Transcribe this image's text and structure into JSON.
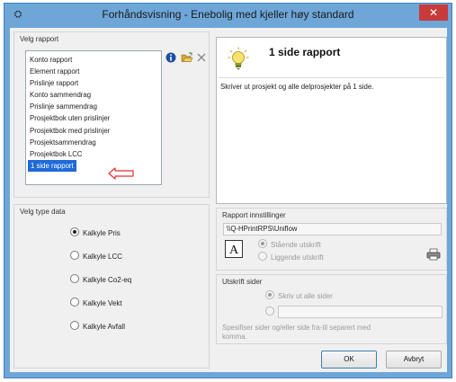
{
  "window": {
    "title": "Forhåndsvisning - Enebolig med kjeller høy standard",
    "close_glyph": "✕"
  },
  "report_group": {
    "label": "Velg rapport",
    "items": [
      "Konto rapport",
      "Element rapport",
      "Prislinje rapport",
      "Konto sammendrag",
      "Prislinje sammendrag",
      "Prosjektbok uten prislinjer",
      "Prosjektbok med prislinjer",
      "Prosjektsammendrag",
      "Prosjektbok LCC",
      "1 side rapport"
    ],
    "selected_index": 9
  },
  "data_type_group": {
    "label": "Velg type data",
    "options": [
      "Kalkyle Pris",
      "Kalkyle LCC",
      "Kalkyle Co2-eq",
      "Kalkyle Vekt",
      "Kalkyle Avfall"
    ],
    "selected_index": 0
  },
  "preview": {
    "title": "1 side rapport",
    "description": "Skriver ut prosjekt og alle delprosjekter på 1 side."
  },
  "report_settings": {
    "label": "Rapport innstillinger",
    "printer": "\\\\Q-HPrintRPS\\Uniflow",
    "orientation_portrait": "Stående utskrift",
    "orientation_landscape": "Liggende utskrift"
  },
  "print_pages": {
    "label": "Utskrift sider",
    "all_pages": "Skriv ut alle sider",
    "range_value": "",
    "hint_line1": "Spesifiser sider og/eller side fra-til separert med",
    "hint_line2": "komma."
  },
  "buttons": {
    "ok": "OK",
    "cancel": "Avbryt"
  },
  "colors": {
    "title_bar": "#6ea6d8",
    "close_button": "#c83b3b",
    "selection": "#1e6ad8",
    "annotation_arrow": "#e03030"
  },
  "icons": [
    "app-icon",
    "info-icon",
    "open-folder-icon",
    "delete-icon",
    "lightbulb-icon",
    "font-icon",
    "printer-icon",
    "arrow-icon"
  ]
}
